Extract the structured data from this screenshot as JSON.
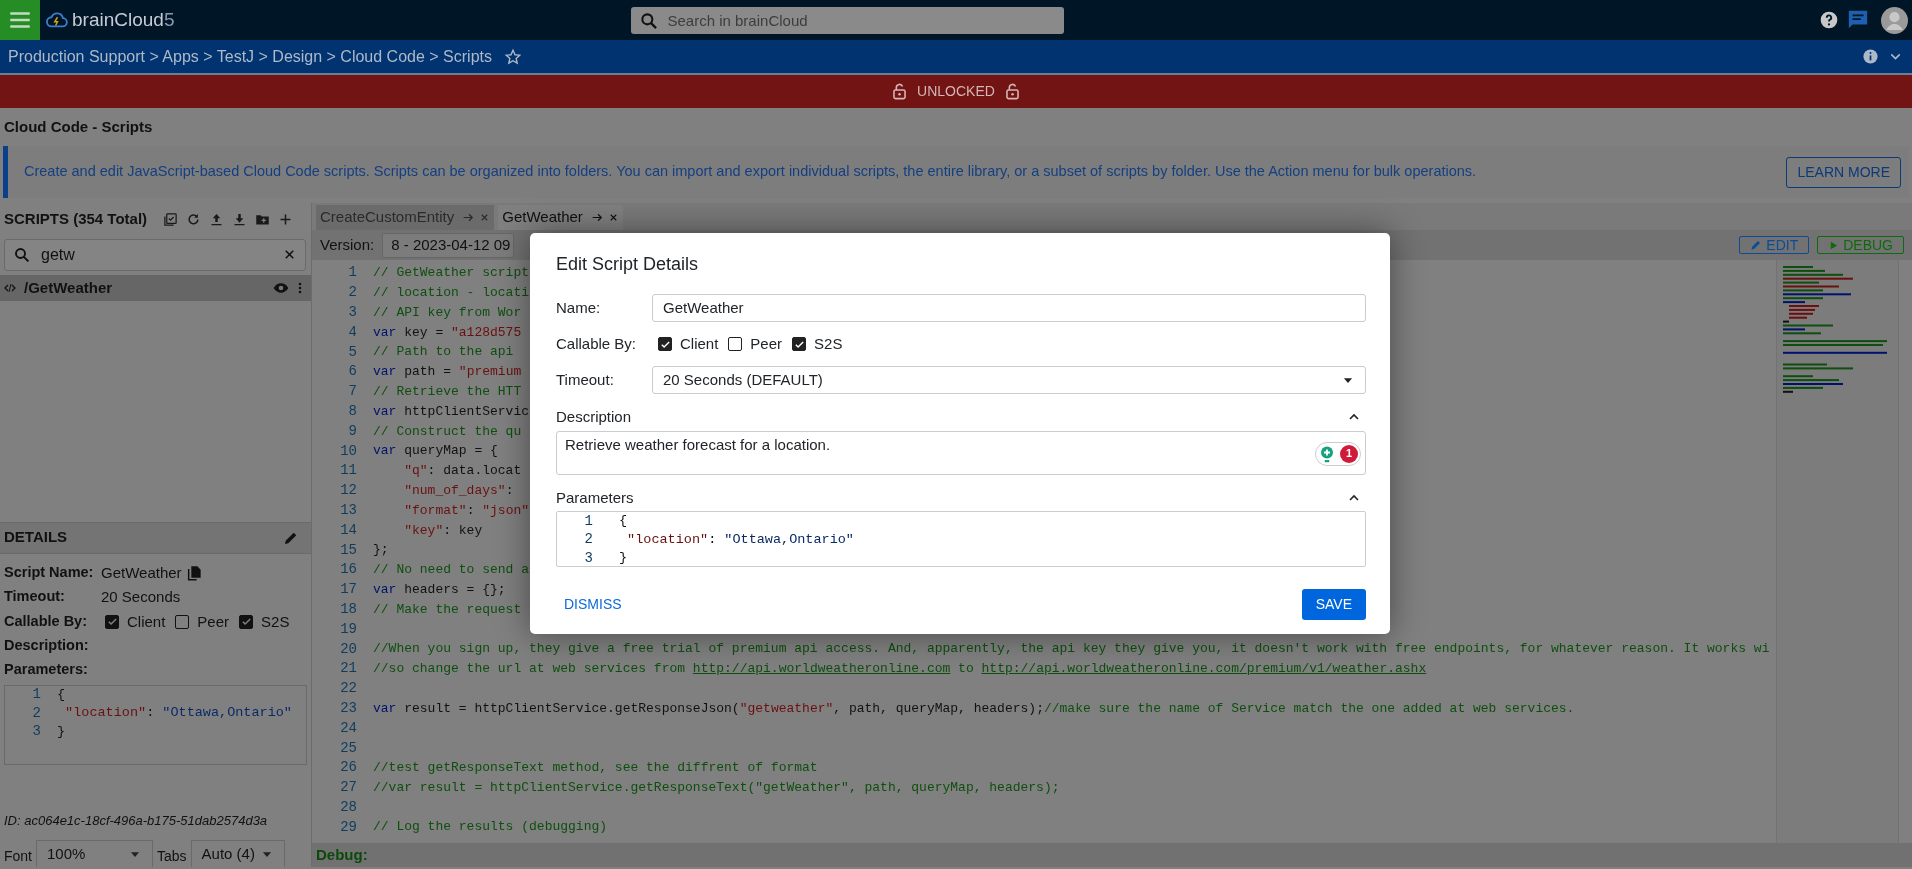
{
  "header": {
    "logo": {
      "name": "brainCloud",
      "suffix": "5"
    },
    "search": {
      "placeholder": "Search in brainCloud"
    }
  },
  "breadcrumb": {
    "path": "Production Support > Apps > TestJ > Design > Cloud Code > Scripts",
    "favorite": false
  },
  "lock_banner": {
    "text": "UNLOCKED",
    "locked": false
  },
  "page_title": "Cloud Code - Scripts",
  "info": {
    "text": "Create and edit JavaScript-based Cloud Code scripts. Scripts can be organized into folders. You can import and export individual scripts, the entire library, or a subset of scripts by folder. Use the Action menu for bulk operations.",
    "button": "LEARN MORE"
  },
  "scripts_panel": {
    "title": "SCRIPTS (354 Total)",
    "search": {
      "value": "getw"
    },
    "items": [
      {
        "label": "/GetWeather",
        "selected": true
      }
    ]
  },
  "details": {
    "title": "DETAILS",
    "script_name": {
      "label": "Script Name:",
      "value": "GetWeather"
    },
    "timeout": {
      "label": "Timeout:",
      "value": "20 Seconds"
    },
    "callable": {
      "label": "Callable By:",
      "options": [
        {
          "label": "Client",
          "checked": true
        },
        {
          "label": "Peer",
          "checked": false
        },
        {
          "label": "S2S",
          "checked": true
        }
      ]
    },
    "description_label": "Description:",
    "parameters_label": "Parameters:",
    "parameters": [
      {
        "n": "1",
        "tokens": [
          {
            "kind": "txt",
            "text": "{"
          }
        ]
      },
      {
        "n": "2",
        "tokens": [
          {
            "kind": "key",
            "text": " \"location\""
          },
          {
            "kind": "txt",
            "text": ": "
          },
          {
            "kind": "val",
            "text": "\"Ottawa,Ontario\""
          }
        ]
      },
      {
        "n": "3",
        "tokens": [
          {
            "kind": "txt",
            "text": "}"
          }
        ]
      }
    ],
    "id": "ID: ac064e1c-18cf-496a-b175-51dab2574d3a",
    "font": {
      "label": "Font",
      "value": "100%"
    },
    "tab_size": {
      "label": "Tabs",
      "value": "Auto (4)"
    }
  },
  "editor": {
    "tabs": [
      {
        "label": "CreateCustomEntity",
        "selected": false
      },
      {
        "label": "GetWeather",
        "selected": true
      }
    ],
    "version": {
      "label": "Version:",
      "value": "8 - 2023-04-12 09"
    },
    "edit_button": "EDIT",
    "debug_button": "DEBUG",
    "code": [
      {
        "n": "1",
        "tokens": [
          {
            "kind": "com",
            "text": "// GetWeather script"
          }
        ]
      },
      {
        "n": "2",
        "tokens": [
          {
            "kind": "com",
            "text": "// location - locati"
          }
        ]
      },
      {
        "n": "3",
        "tokens": [
          {
            "kind": "com",
            "text": "// API key from Wor"
          }
        ]
      },
      {
        "n": "4",
        "tokens": [
          {
            "kind": "kw",
            "text": "var"
          },
          {
            "kind": "txt",
            "text": " key = "
          },
          {
            "kind": "str",
            "text": "\"a128d575"
          }
        ]
      },
      {
        "n": "5",
        "tokens": [
          {
            "kind": "com",
            "text": "// Path to the api"
          }
        ]
      },
      {
        "n": "6",
        "tokens": [
          {
            "kind": "kw",
            "text": "var"
          },
          {
            "kind": "txt",
            "text": " path = "
          },
          {
            "kind": "str",
            "text": "\"premium"
          }
        ]
      },
      {
        "n": "7",
        "tokens": [
          {
            "kind": "com",
            "text": "// Retrieve the HTT"
          }
        ]
      },
      {
        "n": "8",
        "tokens": [
          {
            "kind": "kw",
            "text": "var"
          },
          {
            "kind": "txt",
            "text": " httpClientServic"
          }
        ]
      },
      {
        "n": "9",
        "tokens": [
          {
            "kind": "com",
            "text": "// Construct the qu"
          }
        ]
      },
      {
        "n": "10",
        "tokens": [
          {
            "kind": "kw",
            "text": "var"
          },
          {
            "kind": "txt",
            "text": " queryMap = {"
          }
        ]
      },
      {
        "n": "11",
        "tokens": [
          {
            "kind": "str",
            "text": "    \"q\""
          },
          {
            "kind": "txt",
            "text": ": data.locat"
          }
        ]
      },
      {
        "n": "12",
        "tokens": [
          {
            "kind": "str",
            "text": "    \"num_of_days\""
          },
          {
            "kind": "txt",
            "text": ":"
          }
        ]
      },
      {
        "n": "13",
        "tokens": [
          {
            "kind": "str",
            "text": "    \"format\""
          },
          {
            "kind": "txt",
            "text": ": "
          },
          {
            "kind": "str",
            "text": "\"json\""
          }
        ]
      },
      {
        "n": "14",
        "tokens": [
          {
            "kind": "str",
            "text": "    \"key\""
          },
          {
            "kind": "txt",
            "text": ": key"
          }
        ]
      },
      {
        "n": "15",
        "tokens": [
          {
            "kind": "txt",
            "text": "};"
          }
        ]
      },
      {
        "n": "16",
        "tokens": [
          {
            "kind": "com",
            "text": "// No need to send a"
          }
        ]
      },
      {
        "n": "17",
        "tokens": [
          {
            "kind": "kw",
            "text": "var"
          },
          {
            "kind": "txt",
            "text": " headers = {};"
          }
        ]
      },
      {
        "n": "18",
        "tokens": [
          {
            "kind": "com",
            "text": "// Make the request"
          }
        ]
      },
      {
        "n": "19"
      },
      {
        "n": "20",
        "tokens": [
          {
            "kind": "com",
            "text": "//When you sign up, they give a free trial of premium api access. And, apparently, the api key they give you, it doesn't work with free endpoints, for whatever reason. It works wi"
          }
        ]
      },
      {
        "n": "21",
        "tokens": [
          {
            "kind": "com",
            "text": "//so change the url at web services from "
          },
          {
            "kind": "link",
            "text": "http://api.worldweatheronline.com"
          },
          {
            "kind": "com",
            "text": " to "
          },
          {
            "kind": "link",
            "text": "http://api.worldweatheronline.com/premium/v1/weather.ashx"
          }
        ]
      },
      {
        "n": "22"
      },
      {
        "n": "23",
        "tokens": [
          {
            "kind": "kw",
            "text": "var"
          },
          {
            "kind": "txt",
            "text": " result = httpClientService.getResponseJson("
          },
          {
            "kind": "str",
            "text": "\"getweather\""
          },
          {
            "kind": "txt",
            "text": ", path, queryMap, headers);"
          },
          {
            "kind": "com",
            "text": "//make sure the name of Service match the one added at web services."
          }
        ]
      },
      {
        "n": "24"
      },
      {
        "n": "25"
      },
      {
        "n": "26",
        "tokens": [
          {
            "kind": "com",
            "text": "//test getResponseText method, see the diffrent of format"
          }
        ]
      },
      {
        "n": "27",
        "tokens": [
          {
            "kind": "com",
            "text": "//var result = httpClientService.getResponseText(\"getWeather\", path, queryMap, headers);"
          }
        ]
      },
      {
        "n": "28"
      },
      {
        "n": "29",
        "tokens": [
          {
            "kind": "com",
            "text": "// Log the results (debugging)"
          }
        ]
      }
    ],
    "debug_label": "Debug:"
  },
  "modal": {
    "title": "Edit Script Details",
    "name": {
      "label": "Name:",
      "value": "GetWeather"
    },
    "callable": {
      "label": "Callable By:",
      "options": [
        {
          "label": "Client",
          "checked": true
        },
        {
          "label": "Peer",
          "checked": false
        },
        {
          "label": "S2S",
          "checked": true
        }
      ]
    },
    "timeout": {
      "label": "Timeout:",
      "value": "20 Seconds (DEFAULT)"
    },
    "description": {
      "label": "Description",
      "expanded": true,
      "value": "Retrieve weather forecast for a location.",
      "issue_count": "1"
    },
    "parameters": {
      "label": "Parameters",
      "expanded": true,
      "lines": [
        {
          "n": "1",
          "tokens": [
            {
              "kind": "txt",
              "text": "{"
            }
          ]
        },
        {
          "n": "2",
          "tokens": [
            {
              "kind": "key",
              "text": " \"location\""
            },
            {
              "kind": "txt",
              "text": ": "
            },
            {
              "kind": "val",
              "text": "\"Ottawa,Ontario\""
            }
          ]
        },
        {
          "n": "3",
          "tokens": [
            {
              "kind": "txt",
              "text": "}"
            }
          ]
        }
      ]
    },
    "dismiss": "DISMISS",
    "save": "SAVE"
  }
}
